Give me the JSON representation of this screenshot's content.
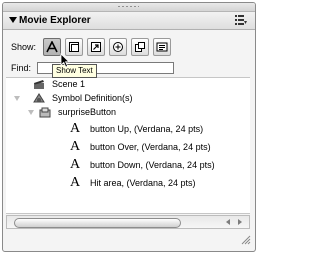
{
  "panel": {
    "title": "Movie Explorer"
  },
  "show": {
    "label": "Show:"
  },
  "toolbar": {
    "buttons": [
      {
        "icon": "text-A-icon",
        "tooltip": "Show Text",
        "active": true
      },
      {
        "icon": "button-clip-icon"
      },
      {
        "icon": "script-arrow-icon"
      },
      {
        "icon": "graphic-icon"
      },
      {
        "icon": "frames-icon"
      },
      {
        "icon": "customize-icon"
      }
    ]
  },
  "find": {
    "label": "Find:",
    "value": ""
  },
  "tooltip": {
    "text": "Show Text"
  },
  "tree": {
    "scene": "Scene 1",
    "symbol_definitions": "Symbol Definition(s)",
    "symbol": "surpriseButton",
    "text_items": [
      "button Up, (Verdana, 24 pts)",
      "button Over, (Verdana, 24 pts)",
      "button Down, (Verdana, 24 pts)",
      "Hit area, (Verdana, 24 pts)"
    ],
    "text_glyph": "A"
  }
}
